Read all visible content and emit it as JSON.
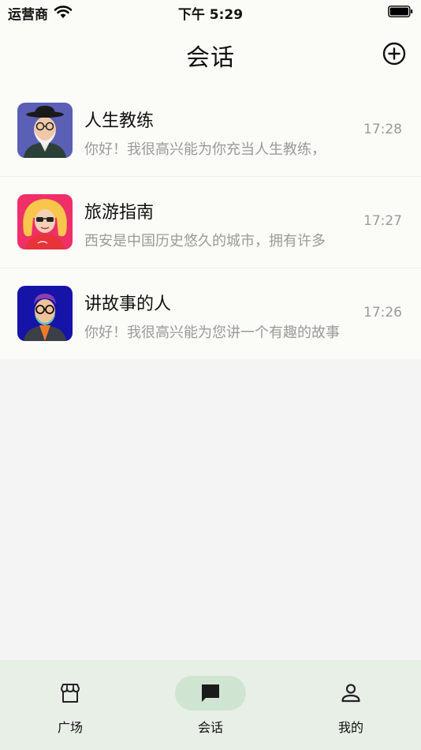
{
  "status_bar": {
    "carrier": "运营商",
    "time": "下午 5:29"
  },
  "header": {
    "title": "会话",
    "add_icon": "plus-circle-icon"
  },
  "conversations": [
    {
      "name": "人生教练",
      "preview": "你好！我很高兴能为你充当人生教练，",
      "time": "17:28",
      "avatar_icon": "old-man-avatar",
      "avatar_bg": "#5b5fb6"
    },
    {
      "name": "旅游指南",
      "preview": "西安是中国历史悠久的城市，拥有许多",
      "time": "17:27",
      "avatar_icon": "blonde-woman-avatar",
      "avatar_bg": "#ee2f68"
    },
    {
      "name": "讲故事的人",
      "preview": "你好！我很高兴能为您讲一个有趣的故事",
      "time": "17:26",
      "avatar_icon": "bearded-man-avatar",
      "avatar_bg": "#1513a8"
    }
  ],
  "tab_bar": {
    "tabs": [
      {
        "label": "广场",
        "icon": "storefront-icon",
        "active": false
      },
      {
        "label": "会话",
        "icon": "chat-bubble-icon",
        "active": true
      },
      {
        "label": "我的",
        "icon": "person-icon",
        "active": false
      }
    ],
    "active_color": "#cfe5d2"
  }
}
